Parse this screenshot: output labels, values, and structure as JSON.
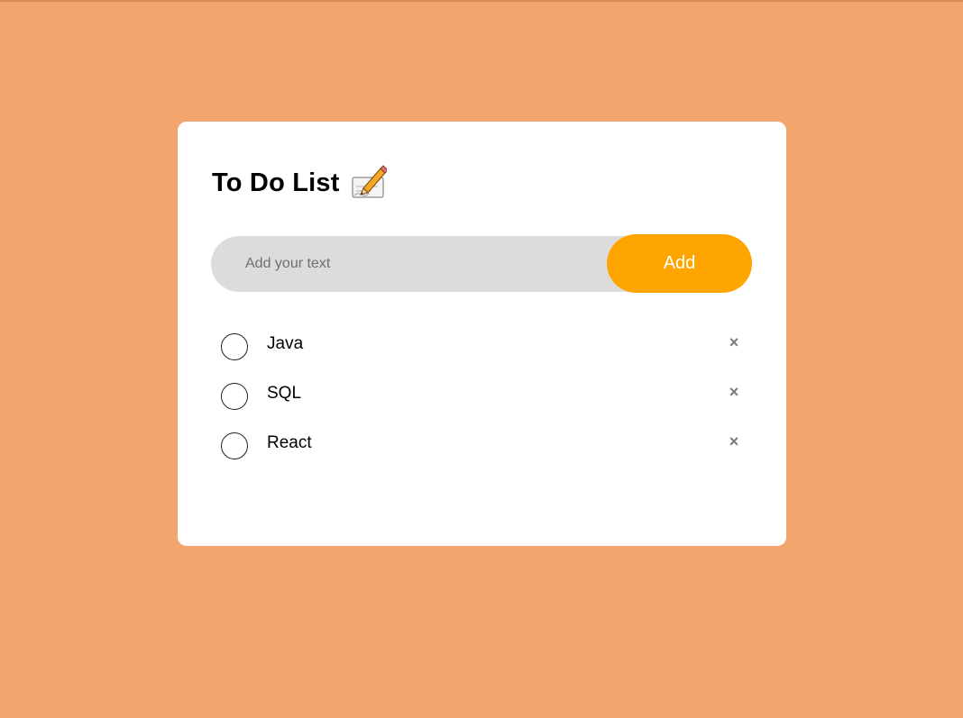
{
  "header": {
    "title": "To Do List",
    "icon": "memo-icon"
  },
  "input": {
    "placeholder": "Add your text",
    "value": ""
  },
  "add_button": {
    "label": "Add"
  },
  "tasks": [
    {
      "label": "Java",
      "checked": false
    },
    {
      "label": "SQL",
      "checked": false
    },
    {
      "label": "React",
      "checked": false
    }
  ],
  "delete_symbol": "×",
  "colors": {
    "background": "#f2a66e",
    "card": "#ffffff",
    "input_bg": "#dcdcdc",
    "accent": "#ffa500",
    "delete": "#7a7a7a"
  }
}
